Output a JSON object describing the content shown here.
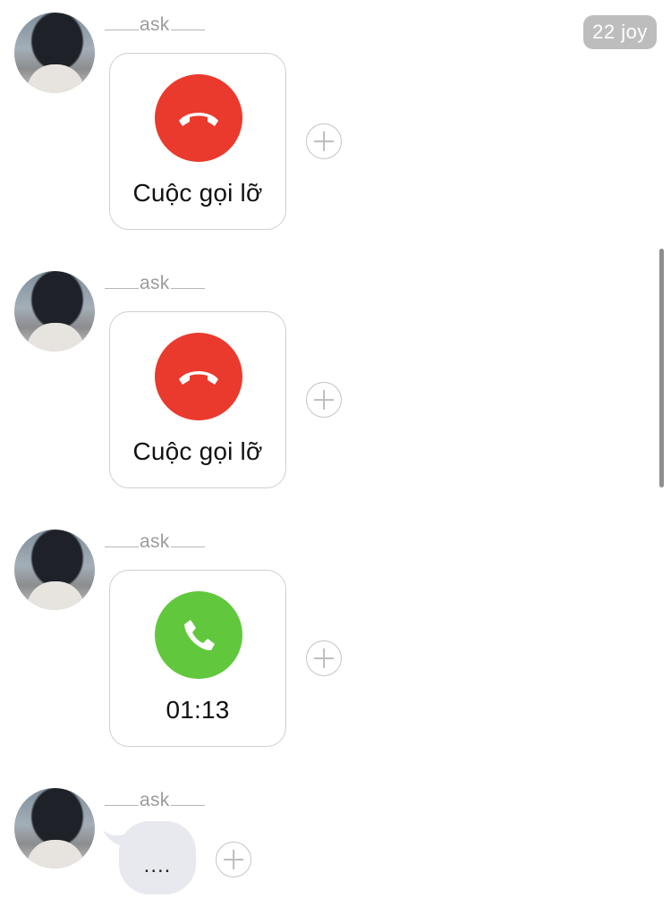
{
  "header_badge": "22 joy",
  "messages": [
    {
      "sender": "ask",
      "type": "call",
      "status": "missed",
      "label": "Cuộc gọi lỡ"
    },
    {
      "sender": "ask",
      "type": "call",
      "status": "missed",
      "label": "Cuộc gọi lỡ"
    },
    {
      "sender": "ask",
      "type": "call",
      "status": "completed",
      "label": "01:13"
    },
    {
      "sender": "ask",
      "type": "typing",
      "text": "...."
    }
  ],
  "icons": {
    "missed_call": "phone-hangup-icon",
    "completed_call": "phone-icon",
    "react": "plus-icon"
  },
  "colors": {
    "missed": "#ea3a2d",
    "completed": "#61c83d",
    "bubble": "#e8e9ee"
  }
}
